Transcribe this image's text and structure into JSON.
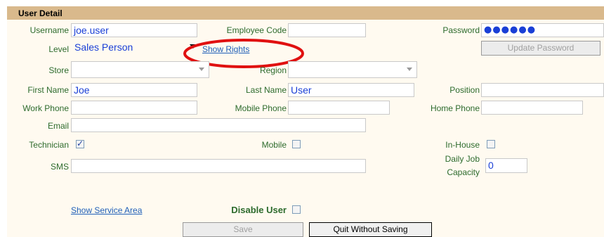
{
  "section_title": "User Detail",
  "labels": {
    "username": "Username",
    "employee_code": "Employee Code",
    "password": "Password",
    "level": "Level",
    "store": "Store",
    "region": "Region",
    "first_name": "First Name",
    "last_name": "Last Name",
    "position": "Position",
    "work_phone": "Work Phone",
    "mobile_phone": "Mobile Phone",
    "home_phone": "Home Phone",
    "email": "Email",
    "technician": "Technician",
    "mobile": "Mobile",
    "in_house": "In-House",
    "sms": "SMS",
    "daily_job_capacity_1": "Daily Job",
    "daily_job_capacity_2": "Capacity",
    "disable_user": "Disable User"
  },
  "values": {
    "username": "joe.user",
    "employee_code": "",
    "password_mask": "●●●●●●",
    "level": "Sales Person",
    "store": "",
    "region": "",
    "first_name": "Joe",
    "last_name": "User",
    "position": "",
    "work_phone": "",
    "mobile_phone": "",
    "home_phone": "",
    "email": "",
    "sms": "",
    "daily_job_capacity": "0"
  },
  "checkboxes": {
    "technician": true,
    "mobile": false,
    "in_house": false,
    "disable_user": false
  },
  "links": {
    "show_rights": "Show Rights",
    "show_service_area": "Show Service Area"
  },
  "buttons": {
    "update_password": "Update Password",
    "save": "Save",
    "quit_without_saving": "Quit Without Saving"
  },
  "icons": {
    "check": "✓"
  },
  "colors": {
    "header_bg": "#d9b98c",
    "label": "#2d6b2d",
    "value": "#1a3fd6",
    "link": "#1f5fb8",
    "annotation": "#e01010"
  }
}
